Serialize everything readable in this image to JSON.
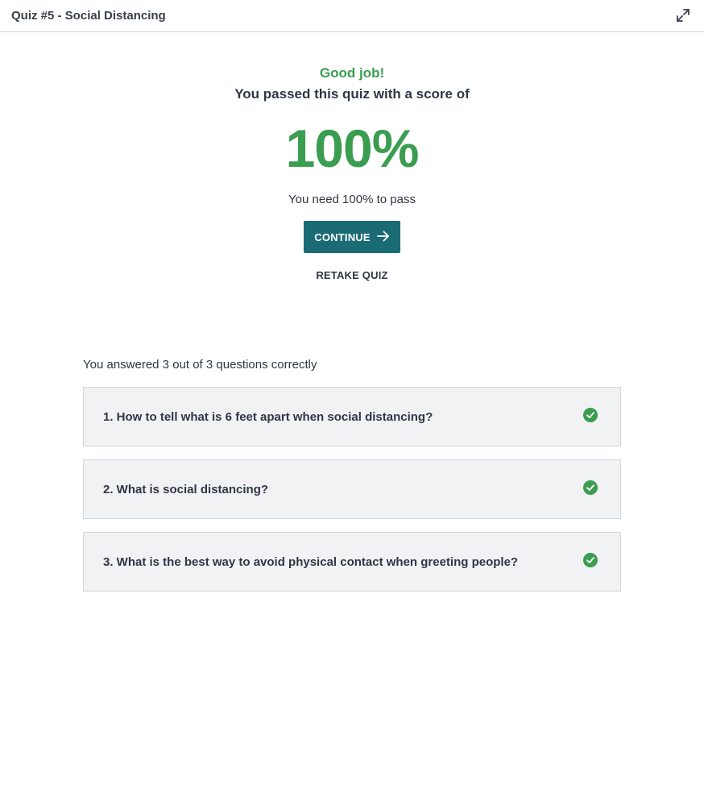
{
  "header": {
    "title": "Quiz #5 - Social Distancing"
  },
  "result": {
    "headline": "Good job!",
    "message": "You passed this quiz with a score of",
    "score": "100%",
    "requirement": "You need 100% to pass",
    "continue_label": "CONTINUE",
    "retake_label": "RETAKE QUIZ"
  },
  "summary": {
    "text": "You answered 3 out of 3 questions correctly"
  },
  "questions": [
    {
      "text": "1. How to tell what is 6 feet apart when social distancing?",
      "status": "correct"
    },
    {
      "text": "2. What is social distancing?",
      "status": "correct"
    },
    {
      "text": "3. What is the best way to avoid physical contact when greeting people?",
      "status": "correct"
    }
  ],
  "colors": {
    "success": "#3a9d4f",
    "primary_button": "#1b6b74"
  },
  "icons": {
    "expand": "expand-icon",
    "arrow": "arrow-right-icon",
    "check": "check-circle-icon"
  }
}
